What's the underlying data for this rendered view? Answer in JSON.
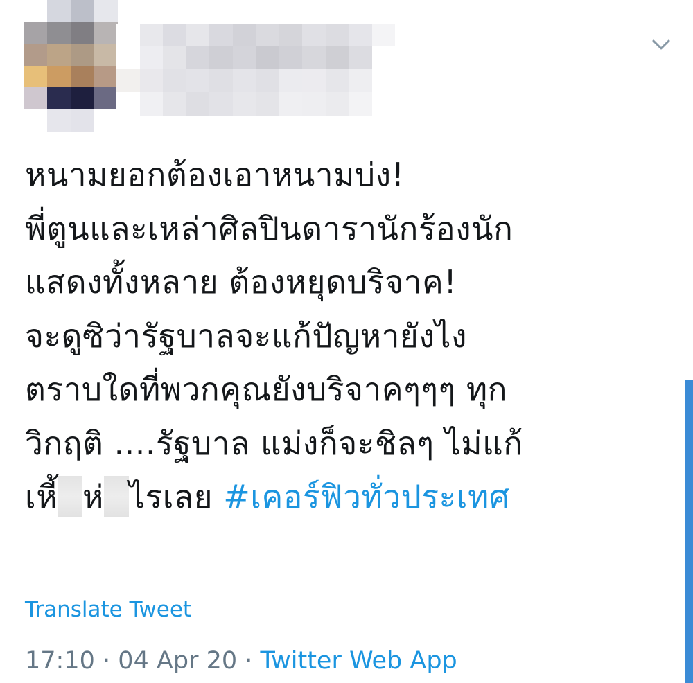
{
  "tweet": {
    "lines": [
      "หนามยอกต้องเอาหนามบ่ง!",
      "พี่ตูนและเหล่าศิลปินดารานักร้องนัก",
      "แสดงทั้งหลาย ต้องหยุดบริจาค!",
      "จะดูซิว่ารัฐบาลจะแก้ปัญหายังไง",
      "ตราบใดที่พวกคุณยังบริจาคๆๆๆ ทุก",
      "วิกฤติ ....รัฐบาล แม่งก็จะชิลๆ ไม่แก้"
    ],
    "last_line": {
      "part1": "เหี้",
      "part2": "ห่",
      "part3": "ไรเลย ",
      "hashtag": "#เคอร์ฟิวทั่วประเทศ"
    },
    "translate_label": "Translate Tweet",
    "meta": {
      "time": "17:10",
      "separator": " · ",
      "date": "04 Apr 20",
      "source": "Twitter Web App"
    }
  },
  "icons": {
    "menu": "chevron-down-icon"
  },
  "colors": {
    "link": "#1b95e0",
    "text": "#14171a",
    "muted": "#657786",
    "scrollbar": "#3b8bd6"
  }
}
